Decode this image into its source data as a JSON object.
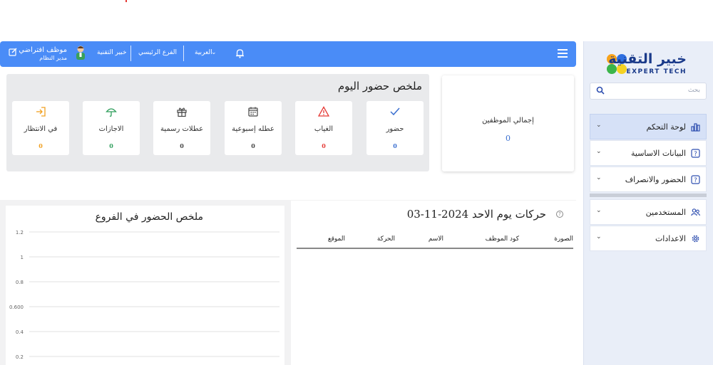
{
  "brand": {
    "name_ar": "خبير التقنية",
    "name_en": "EXPERT TECH",
    "colors": {
      "orange": "#f7a21b",
      "blue": "#2f6fe0",
      "green": "#3bb54a",
      "yellow": "#f5d223"
    }
  },
  "search": {
    "placeholder": "بحث",
    "icon": "search-icon"
  },
  "sidebar": {
    "items": [
      {
        "label": "لوحة التحكم",
        "icon": "dashboard-icon",
        "active": true
      },
      {
        "label": "البيانات الاساسية",
        "icon": "help-icon",
        "active": false
      },
      {
        "label": "الحضور والانصراف",
        "icon": "help-icon",
        "active": false
      },
      {
        "label": "المستخدمين",
        "icon": "users-icon",
        "active": false
      },
      {
        "label": "الاعدادات",
        "icon": "gear-icon",
        "active": false
      }
    ]
  },
  "topbar": {
    "user_name": "موظف افتراضي",
    "user_role": "مدير النظام",
    "company": "خبير التقنية",
    "branch": "الفرع الرئيسي",
    "language": "العربية",
    "accent": "#4a8cf7"
  },
  "summary": {
    "title": "ملخص حضور اليوم",
    "cards": [
      {
        "label": "حضور",
        "value": "0",
        "icon": "check-icon",
        "color": "#3a6fd0"
      },
      {
        "label": "الغياب",
        "value": "0",
        "icon": "warning-icon",
        "color": "#e53935"
      },
      {
        "label": "عطله إسبوعية",
        "value": "0",
        "icon": "calendar-icon",
        "color": "#444444"
      },
      {
        "label": "عطلات رسمية",
        "value": "0",
        "icon": "gift-icon",
        "color": "#444444"
      },
      {
        "label": "الاجازات",
        "value": "0",
        "icon": "umbrella-icon",
        "color": "#2e9e5b"
      },
      {
        "label": "في الانتظار",
        "value": "0",
        "icon": "login-icon",
        "color": "#f0a020"
      }
    ]
  },
  "total": {
    "label": "إجمالي الموظفين",
    "value": "0"
  },
  "chart_data": {
    "type": "bar",
    "title": "ملخص الحضور في الفروع",
    "categories": [],
    "series": [],
    "yticks": [
      "1.2",
      "1",
      "0.8",
      "0.600",
      "0.4",
      "0.2"
    ],
    "ylim": [
      0,
      1.2
    ],
    "grid": true
  },
  "moves": {
    "title": "حركات يوم الاحد 2024-11-03",
    "help": "?",
    "columns": [
      "الصورة",
      "كود الموظف",
      "الاسم",
      "الحركة",
      "الموقع"
    ]
  }
}
